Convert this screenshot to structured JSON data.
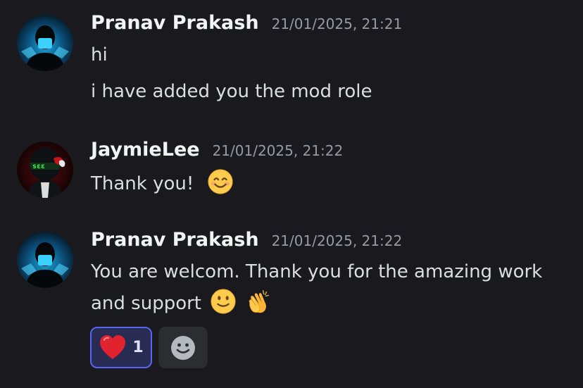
{
  "messages": [
    {
      "author": "Pranav Prakash",
      "timestamp": "21/01/2025, 21:21",
      "avatar": "masked-figure-avatar",
      "lines": [
        "hi",
        "i have added you the mod role"
      ]
    },
    {
      "author": "JaymieLee",
      "timestamp": "21/01/2025, 21:22",
      "avatar": "green-eyed-figure-avatar",
      "lines": [
        "Thank you!"
      ],
      "emoji": [
        "smiling-face-emoji"
      ]
    },
    {
      "author": "Pranav Prakash",
      "timestamp": "21/01/2025, 21:22",
      "avatar": "masked-figure-avatar",
      "lines": [
        "You are welcom. Thank you for the amazing work",
        "and support"
      ],
      "emoji": [
        "slightly-smiling-face-emoji",
        "clapping-hands-emoji"
      ]
    }
  ],
  "reactions": [
    {
      "icon": "red-heart-emoji",
      "count": "1",
      "active": true
    }
  ],
  "add_reaction_icon": "add-reaction-smiley-icon",
  "colors": {
    "background": "#1a1a1e",
    "username": "#f2f3f5",
    "timestamp": "#949ba4",
    "message_text": "#dbdee1",
    "reaction_active_bg": "#282b52",
    "reaction_active_border": "#5865f2",
    "add_reaction_bg": "#2b2d31"
  }
}
